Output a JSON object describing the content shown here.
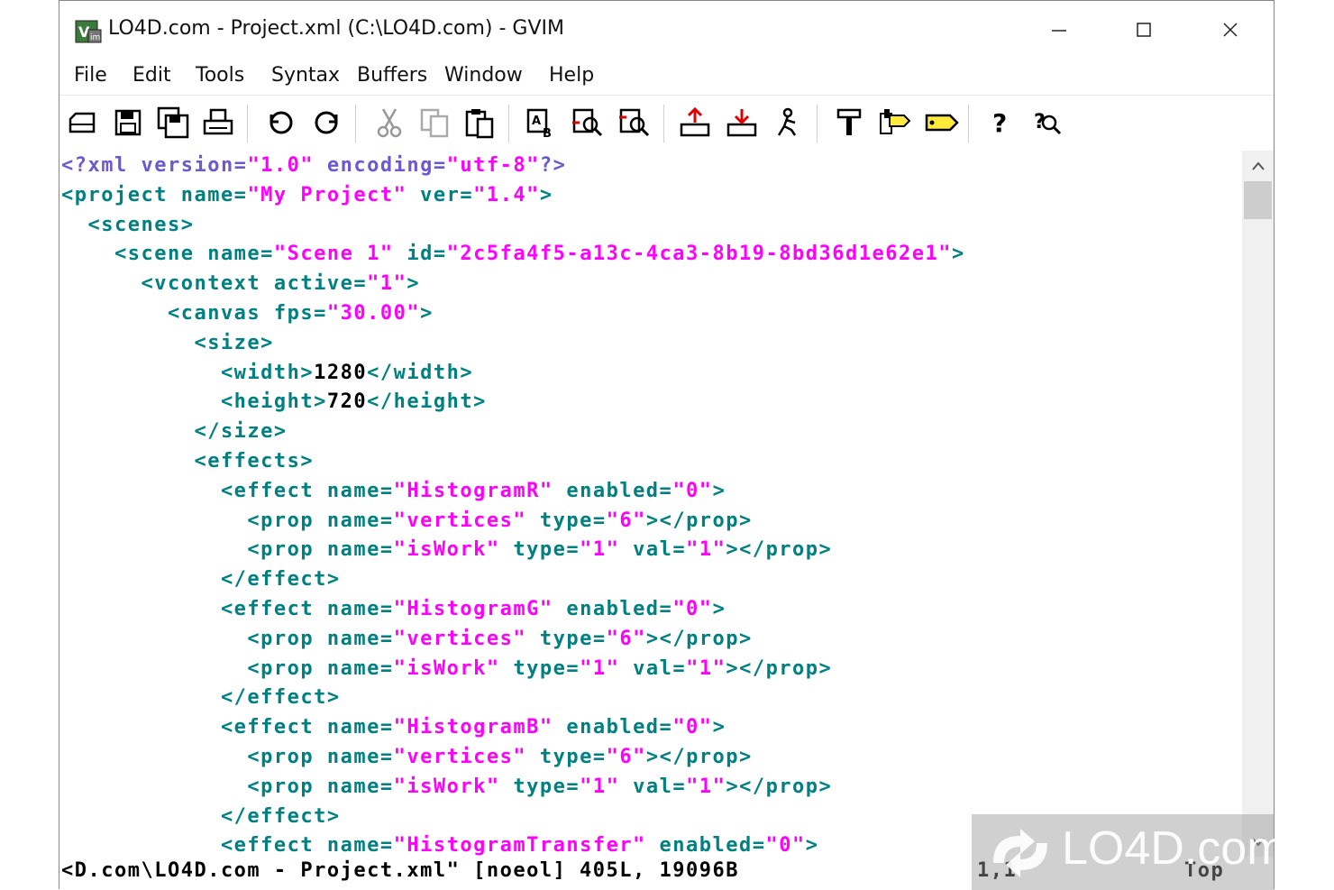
{
  "window": {
    "title": "LO4D.com - Project.xml (C:\\LO4D.com) - GVIM"
  },
  "menu": [
    "File",
    "Edit",
    "Tools",
    "Syntax",
    "Buffers",
    "Window",
    "Help"
  ],
  "toolbar_icons": [
    "open-icon",
    "save-icon",
    "save-all-icon",
    "print-icon",
    "undo-icon",
    "redo-icon",
    "cut-icon",
    "copy-icon",
    "paste-icon",
    "find-replace-icon",
    "find-next-icon",
    "find-prev-icon",
    "load-session-icon",
    "save-session-icon",
    "run-script-icon",
    "make-icon",
    "run-ctags-icon",
    "jump-tag-icon",
    "help-icon",
    "find-help-icon"
  ],
  "code_lines": [
    [
      [
        "pi",
        "<?xml version="
      ],
      [
        "s",
        "\"1.0\""
      ],
      [
        "pi",
        " encoding="
      ],
      [
        "s",
        "\"utf-8\""
      ],
      [
        "pi",
        "?>"
      ]
    ],
    [
      [
        "t",
        "<project name="
      ],
      [
        "s",
        "\"My Project\""
      ],
      [
        "t",
        " ver="
      ],
      [
        "s",
        "\"1.4\""
      ],
      [
        "t",
        ">"
      ]
    ],
    [
      [
        "t",
        "  <scenes>"
      ]
    ],
    [
      [
        "t",
        "    <scene name="
      ],
      [
        "s",
        "\"Scene 1\""
      ],
      [
        "t",
        " id="
      ],
      [
        "s",
        "\"2c5fa4f5-a13c-4ca3-8b19-8bd36d1e62e1\""
      ],
      [
        "t",
        ">"
      ]
    ],
    [
      [
        "t",
        "      <vcontext active="
      ],
      [
        "s",
        "\"1\""
      ],
      [
        "t",
        ">"
      ]
    ],
    [
      [
        "t",
        "        <canvas fps="
      ],
      [
        "s",
        "\"30.00\""
      ],
      [
        "t",
        ">"
      ]
    ],
    [
      [
        "t",
        "          <size>"
      ]
    ],
    [
      [
        "t",
        "            <width>"
      ],
      [
        "x",
        "1280"
      ],
      [
        "t",
        "</width>"
      ]
    ],
    [
      [
        "t",
        "            <height>"
      ],
      [
        "x",
        "720"
      ],
      [
        "t",
        "</height>"
      ]
    ],
    [
      [
        "t",
        "          </size>"
      ]
    ],
    [
      [
        "t",
        "          <effects>"
      ]
    ],
    [
      [
        "t",
        "            <effect name="
      ],
      [
        "s",
        "\"HistogramR\""
      ],
      [
        "t",
        " enabled="
      ],
      [
        "s",
        "\"0\""
      ],
      [
        "t",
        ">"
      ]
    ],
    [
      [
        "t",
        "              <prop name="
      ],
      [
        "s",
        "\"vertices\""
      ],
      [
        "t",
        " type="
      ],
      [
        "s",
        "\"6\""
      ],
      [
        "t",
        "></prop>"
      ]
    ],
    [
      [
        "t",
        "              <prop name="
      ],
      [
        "s",
        "\"isWork\""
      ],
      [
        "t",
        " type="
      ],
      [
        "s",
        "\"1\""
      ],
      [
        "t",
        " val="
      ],
      [
        "s",
        "\"1\""
      ],
      [
        "t",
        "></prop>"
      ]
    ],
    [
      [
        "t",
        "            </effect>"
      ]
    ],
    [
      [
        "t",
        "            <effect name="
      ],
      [
        "s",
        "\"HistogramG\""
      ],
      [
        "t",
        " enabled="
      ],
      [
        "s",
        "\"0\""
      ],
      [
        "t",
        ">"
      ]
    ],
    [
      [
        "t",
        "              <prop name="
      ],
      [
        "s",
        "\"vertices\""
      ],
      [
        "t",
        " type="
      ],
      [
        "s",
        "\"6\""
      ],
      [
        "t",
        "></prop>"
      ]
    ],
    [
      [
        "t",
        "              <prop name="
      ],
      [
        "s",
        "\"isWork\""
      ],
      [
        "t",
        " type="
      ],
      [
        "s",
        "\"1\""
      ],
      [
        "t",
        " val="
      ],
      [
        "s",
        "\"1\""
      ],
      [
        "t",
        "></prop>"
      ]
    ],
    [
      [
        "t",
        "            </effect>"
      ]
    ],
    [
      [
        "t",
        "            <effect name="
      ],
      [
        "s",
        "\"HistogramB\""
      ],
      [
        "t",
        " enabled="
      ],
      [
        "s",
        "\"0\""
      ],
      [
        "t",
        ">"
      ]
    ],
    [
      [
        "t",
        "              <prop name="
      ],
      [
        "s",
        "\"vertices\""
      ],
      [
        "t",
        " type="
      ],
      [
        "s",
        "\"6\""
      ],
      [
        "t",
        "></prop>"
      ]
    ],
    [
      [
        "t",
        "              <prop name="
      ],
      [
        "s",
        "\"isWork\""
      ],
      [
        "t",
        " type="
      ],
      [
        "s",
        "\"1\""
      ],
      [
        "t",
        " val="
      ],
      [
        "s",
        "\"1\""
      ],
      [
        "t",
        "></prop>"
      ]
    ],
    [
      [
        "t",
        "            </effect>"
      ]
    ],
    [
      [
        "t",
        "            <effect name="
      ],
      [
        "s",
        "\"HistogramTransfer\""
      ],
      [
        "t",
        " enabled="
      ],
      [
        "s",
        "\"0\""
      ],
      [
        "t",
        ">"
      ]
    ]
  ],
  "status": {
    "file_info": "<D.com\\LO4D.com - Project.xml\" [noeol] 405L, 19096B",
    "cursor_pos": "1,1",
    "scroll_pos": "Top"
  },
  "watermark": {
    "text": "LO4D.com"
  },
  "colors": {
    "tag": "#008080",
    "string": "#ff00ff",
    "pi": "#6a5acd",
    "text": "#000000"
  }
}
